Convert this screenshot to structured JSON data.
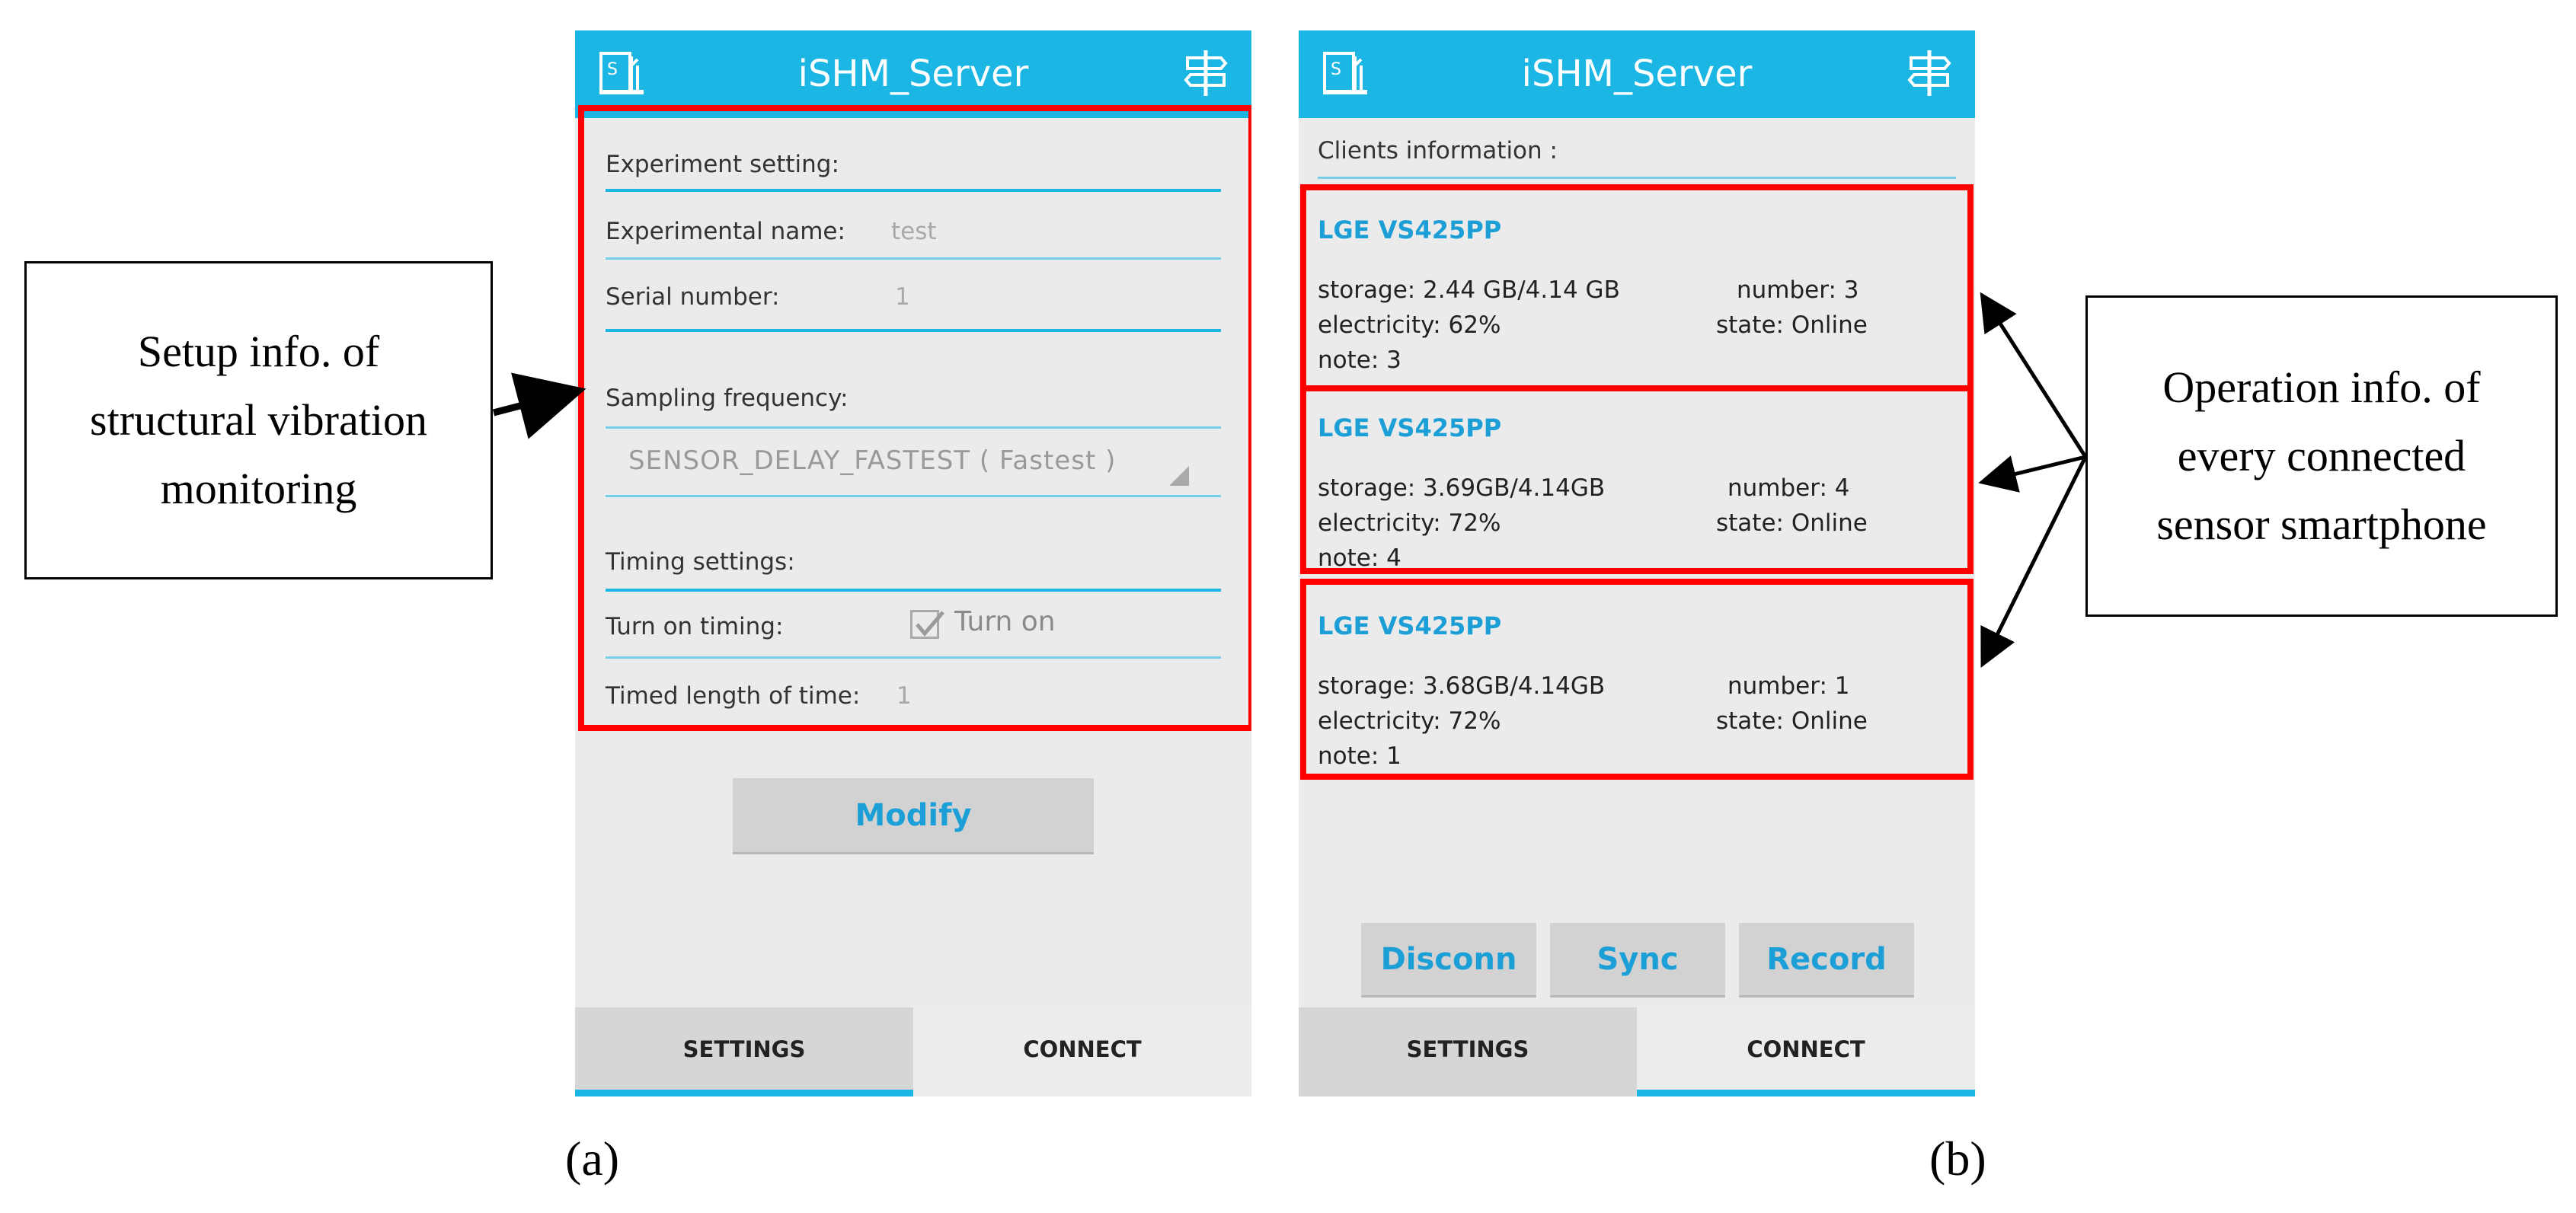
{
  "app": {
    "title": "iSHM_Server",
    "colors": {
      "accent": "#1cb6e4",
      "button_text": "#1c9fd6",
      "highlight": "#ff0000"
    }
  },
  "panel_a": {
    "section_experiment": "Experiment setting:",
    "experimental_name_label": "Experimental name:",
    "experimental_name_value": "test",
    "serial_number_label": "Serial number:",
    "serial_number_value": "1",
    "sampling_label": "Sampling frequency:",
    "sampling_value": "SENSOR_DELAY_FASTEST ( Fastest )",
    "timing_section": "Timing settings:",
    "turn_on_label": "Turn on timing:",
    "turn_on_checkbox_label": "Turn on",
    "turn_on_checked": true,
    "timed_length_label": "Timed length of time:",
    "timed_length_value": "1",
    "modify_button": "Modify",
    "caption": "(a)"
  },
  "panel_b": {
    "clients_title": "Clients information :",
    "clients": [
      {
        "device": "LGE  VS425PP",
        "storage": "storage: 2.44 GB/4.14 GB",
        "number": "number: 3",
        "electricity": "electricity: 62%",
        "state": "state: Online",
        "note": "note: 3"
      },
      {
        "device": "LGE  VS425PP",
        "storage": "storage: 3.69GB/4.14GB",
        "number": "number: 4",
        "electricity": "electricity: 72%",
        "state": "state: Online",
        "note": "note: 4"
      },
      {
        "device": "LGE  VS425PP",
        "storage": "storage: 3.68GB/4.14GB",
        "number": "number: 1",
        "electricity": "electricity: 72%",
        "state": "state: Online",
        "note": "note: 1"
      }
    ],
    "buttons": {
      "disconn": "Disconn",
      "sync": "Sync",
      "record": "Record"
    },
    "caption": "(b)"
  },
  "tabs": {
    "settings": "SETTINGS",
    "connect": "CONNECT"
  },
  "callouts": {
    "left": [
      "Setup info. of",
      "structural vibration",
      "monitoring"
    ],
    "right": [
      "Operation info. of",
      "every connected",
      "sensor smartphone"
    ]
  },
  "icons": {
    "app_logo": "app-logo-icon",
    "signpost": "signpost-icon",
    "checkmark": "checkmark-icon"
  }
}
